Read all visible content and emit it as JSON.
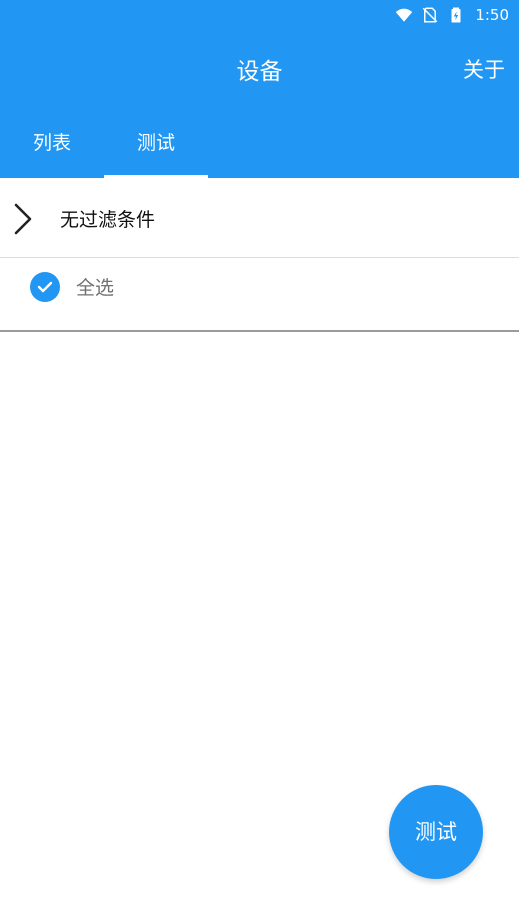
{
  "status_bar": {
    "time": "1:50",
    "icons": [
      "wifi-icon",
      "no-sim-icon",
      "battery-charging-icon"
    ]
  },
  "app_bar": {
    "title": "设备",
    "about_label": "关于"
  },
  "tabs": [
    {
      "label": "列表",
      "selected": false
    },
    {
      "label": "测试",
      "selected": true
    }
  ],
  "filter": {
    "label": "无过滤条件",
    "icon": "chevron-right-icon"
  },
  "select_all": {
    "label": "全选",
    "checked": true
  },
  "fab": {
    "label": "测试"
  },
  "colors": {
    "primary": "#2196F3",
    "on_primary": "#ffffff",
    "text_primary": "#111111",
    "text_secondary": "#707070"
  }
}
